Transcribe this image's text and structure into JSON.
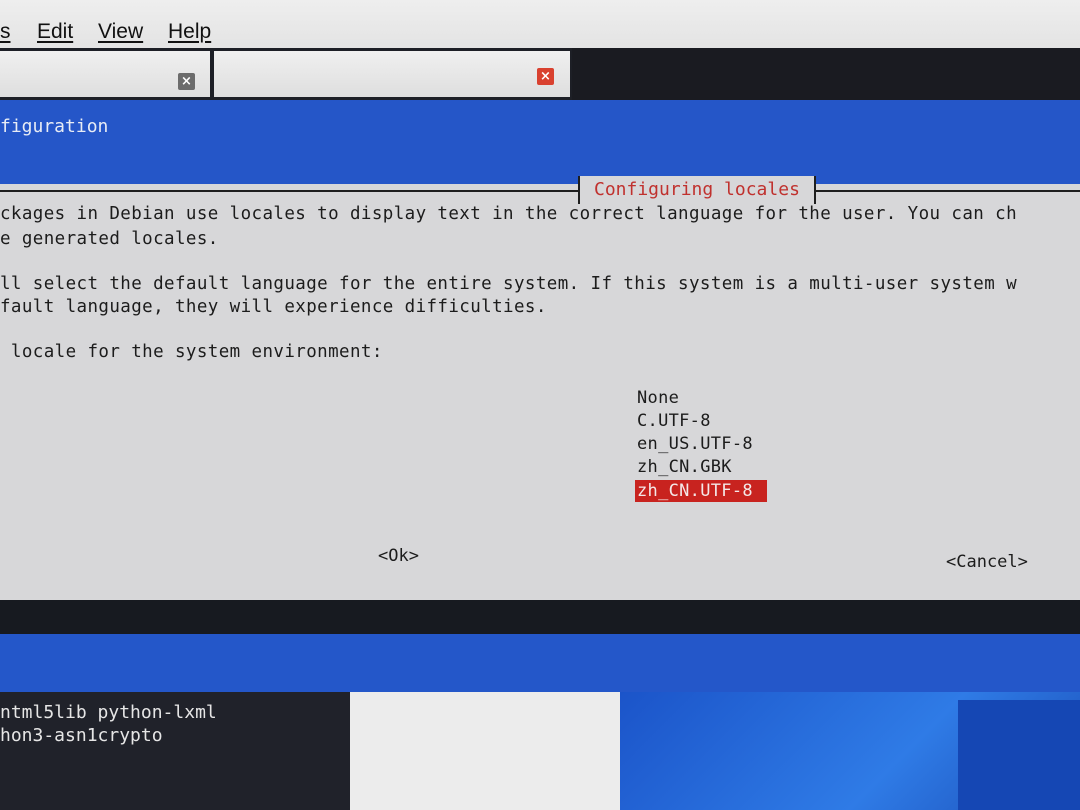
{
  "menubar": {
    "items": [
      "s",
      "Edit",
      "View",
      "Help"
    ]
  },
  "tabs": {
    "close_glyph": "×"
  },
  "window": {
    "title": "figuration"
  },
  "dialog": {
    "title": "Configuring locales",
    "lines": [
      "ckages in Debian use locales to display text in the correct language for the user. You can ch",
      "e generated locales.",
      "ll select the default language for the entire system. If this system is a multi-user system w",
      "fault language, they will experience difficulties.",
      " locale for the system environment:"
    ],
    "options": [
      "None",
      "C.UTF-8",
      "en_US.UTF-8",
      "zh_CN.GBK",
      "zh_CN.UTF-8"
    ],
    "selected_option": "zh_CN.UTF-8",
    "ok_label": "<Ok>",
    "cancel_label": "<Cancel>"
  },
  "bottom_terminal": {
    "lines": [
      "ntml5lib python-lxml",
      "hon3-asn1crypto"
    ]
  },
  "colors": {
    "terminal_blue": "#2556c8",
    "dialog_bg": "#d7d7d9",
    "title_red": "#c0312e",
    "selection_red": "#c8231f"
  }
}
